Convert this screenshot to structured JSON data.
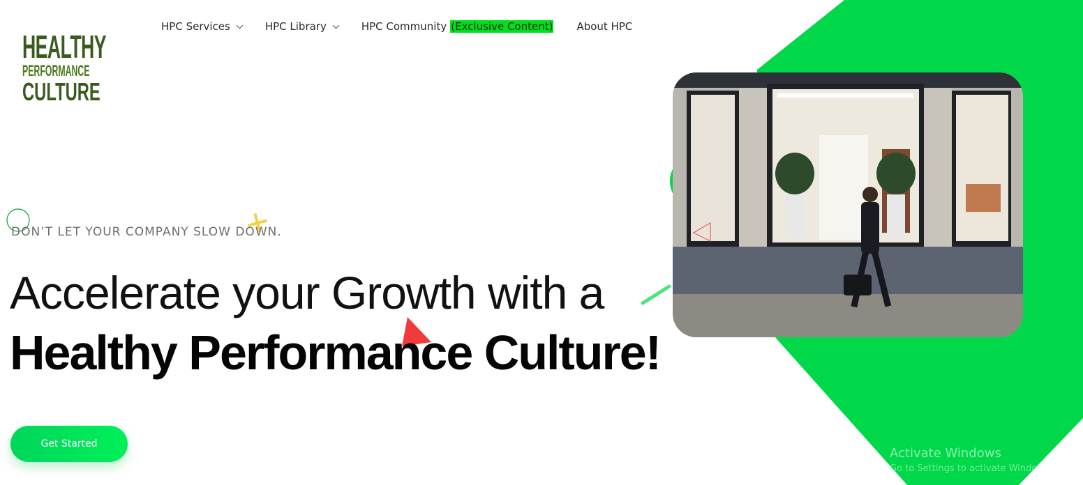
{
  "logo": {
    "line1": "HEALTHY",
    "line2": "PERFORMANCE",
    "line3": "CULTURE"
  },
  "nav": {
    "items": [
      {
        "label": "HPC Services",
        "has_dropdown": true
      },
      {
        "label": "HPC Library",
        "has_dropdown": true
      },
      {
        "label": "HPC Community",
        "highlight": "(Exclusive Content)",
        "has_dropdown": false
      },
      {
        "label": "About HPC",
        "has_dropdown": false
      }
    ]
  },
  "hero": {
    "tagline": "DON’T LET YOUR COMPANY SLOW DOWN.",
    "headline_line1": "Accelerate your Growth with a",
    "headline_line2": "Healthy Performance Culture!",
    "cta_label": "Get Started"
  },
  "watermark": {
    "title": "Activate Windows",
    "subtitle": "Go to Settings to activate Windows."
  },
  "colors": {
    "accent_green": "#00d84a",
    "logo_green": "#3b5a1e",
    "highlight_green": "#00e021",
    "text_dark": "#111111"
  }
}
